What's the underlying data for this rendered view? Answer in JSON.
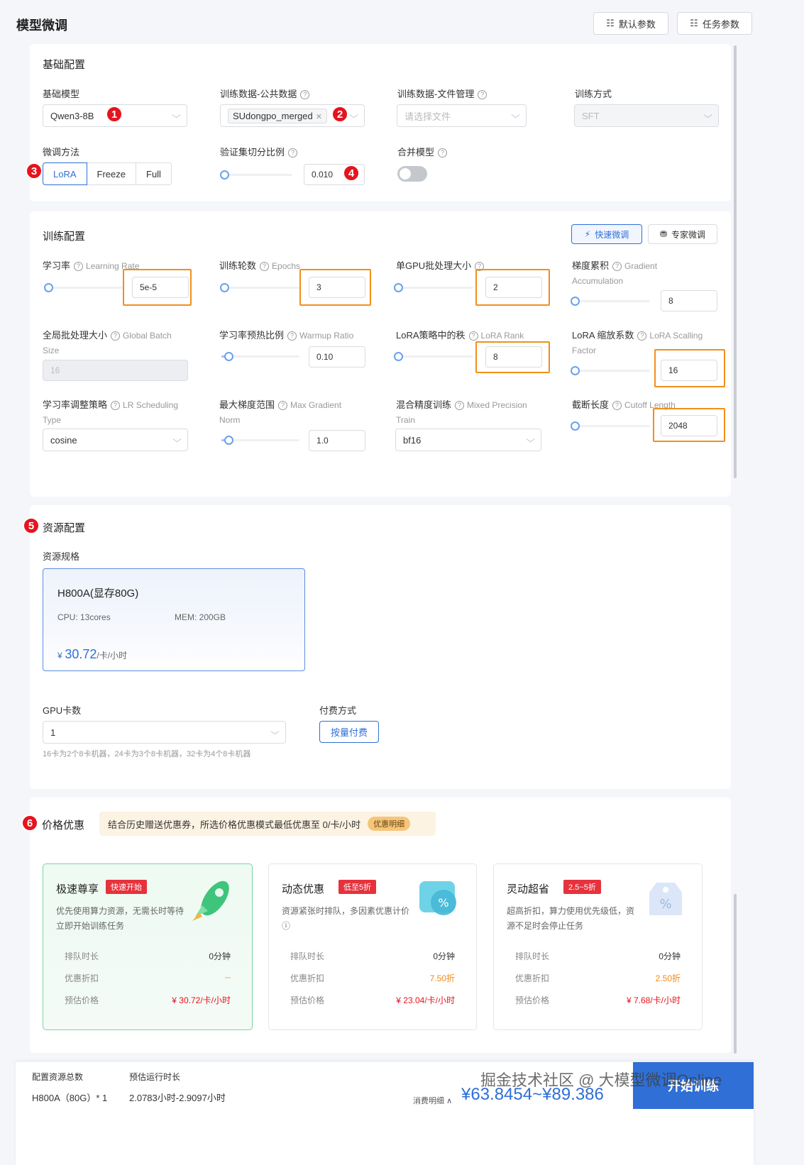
{
  "page": {
    "title": "模型微调"
  },
  "toolbar": {
    "default_params": "默认参数",
    "task_params": "任务参数"
  },
  "basic": {
    "title": "基础配置",
    "base_model": {
      "label": "基础模型",
      "value": "Qwen3-8B"
    },
    "public_data": {
      "label": "训练数据-公共数据",
      "tag": "SUdongpo_merged"
    },
    "file_data": {
      "label": "训练数据-文件管理",
      "placeholder": "请选择文件"
    },
    "train_mode": {
      "label": "训练方式",
      "value": "SFT"
    },
    "finetune_method": {
      "label": "微调方法",
      "options": [
        "LoRA",
        "Freeze",
        "Full"
      ],
      "selected": "LoRA"
    },
    "val_split": {
      "label": "验证集切分比例",
      "value": "0.010"
    },
    "merge_model": {
      "label": "合并模型",
      "enabled": false
    }
  },
  "training": {
    "title": "训练配置",
    "quick_btn": "快速微调",
    "expert_btn": "专家微调",
    "lr": {
      "label": "学习率",
      "en": "Learning Rate",
      "value": "5e-5"
    },
    "epochs": {
      "label": "训练轮数",
      "en": "Epochs",
      "value": "3"
    },
    "gpu_batch": {
      "label": "单GPU批处理大小",
      "value": "2"
    },
    "grad_acc": {
      "label": "梯度累积",
      "en1": "Gradient",
      "en2": "Accumulation",
      "value": "8"
    },
    "global_batch": {
      "label": "全局批处理大小",
      "en1": "Global Batch",
      "en2": "Size",
      "value": "16"
    },
    "warmup": {
      "label": "学习率预热比例",
      "en": "Warmup Ratio",
      "value": "0.10"
    },
    "lora_rank": {
      "label": "LoRA策略中的秩",
      "en": "LoRA Rank",
      "value": "8"
    },
    "lora_scale": {
      "label": "LoRA 缩放系数",
      "en1": "LoRA Scalling",
      "en2": "Factor",
      "value": "16"
    },
    "lr_sched": {
      "label": "学习率调整策略",
      "en1": "LR Scheduling",
      "en2": "Type",
      "value": "cosine"
    },
    "max_grad": {
      "label": "最大梯度范围",
      "en1": "Max Gradient",
      "en2": "Norm",
      "value": "1.0"
    },
    "mixed_prec": {
      "label": "混合精度训练",
      "en1": "Mixed Precision",
      "en2": "Train",
      "value": "bf16"
    },
    "cutoff": {
      "label": "截断长度",
      "en": "Cutoff Length",
      "value": "2048"
    }
  },
  "resource": {
    "title": "资源配置",
    "spec_label": "资源规格",
    "gpu_name": "H800A(显存80G)",
    "cpu": "CPU: 13cores",
    "mem": "MEM: 200GB",
    "price_symbol": "¥",
    "price": "30.72",
    "price_unit": "/卡/小时",
    "gpu_count_label": "GPU卡数",
    "gpu_count": "1",
    "gpu_hint": "16卡为2个8卡机器，24卡为3个8卡机器，32卡为4个8卡机器",
    "pay_label": "付费方式",
    "pay_btn": "按量付费"
  },
  "pricing": {
    "title": "价格优惠",
    "notice": "结合历史赠送优惠券，所选价格优惠模式最低优惠至 0/卡/小时",
    "notice_pill": "优惠明细",
    "cards": [
      {
        "title": "极速尊享",
        "tag": "快速开始",
        "desc": "优先使用算力资源，无需长时等待立即开始训练任务",
        "rows": [
          [
            "排队时长",
            "0分钟"
          ],
          [
            "优惠折扣",
            "--"
          ],
          [
            "预估价格",
            "¥ 30.72/卡/小时"
          ]
        ]
      },
      {
        "title": "动态优惠",
        "tag": "低至5折",
        "desc": "资源紧张时排队，多因素优惠计价 ⓘ",
        "rows": [
          [
            "排队时长",
            "0分钟"
          ],
          [
            "优惠折扣",
            "7.50折"
          ],
          [
            "预估价格",
            "¥ 23.04/卡/小时"
          ]
        ]
      },
      {
        "title": "灵动超省",
        "tag": "2.5~5折",
        "desc": "超高折扣，算力使用优先级低，资源不足时会停止任务",
        "rows": [
          [
            "排队时长",
            "0分钟"
          ],
          [
            "优惠折扣",
            "2.50折"
          ],
          [
            "预估价格",
            "¥ 7.68/卡/小时"
          ]
        ]
      }
    ]
  },
  "footer": {
    "total_label": "配置资源总数",
    "total_value": "H800A（80G）* 1",
    "runtime_label": "预估运行时长",
    "runtime_value": "2.0783小时-2.9097小时",
    "cost_label": "消费明细",
    "cost_value": "¥63.8454~¥89.386",
    "start_btn": "开始训练",
    "watermark": "掘金技术社区 @ 大模型微调Online"
  },
  "badges": [
    "1",
    "2",
    "3",
    "4",
    "5",
    "6"
  ],
  "colors": {
    "primary": "#2f6fd6",
    "highlight": "#f0901a",
    "badge": "#e5141e",
    "price": "#2f6fd6"
  }
}
